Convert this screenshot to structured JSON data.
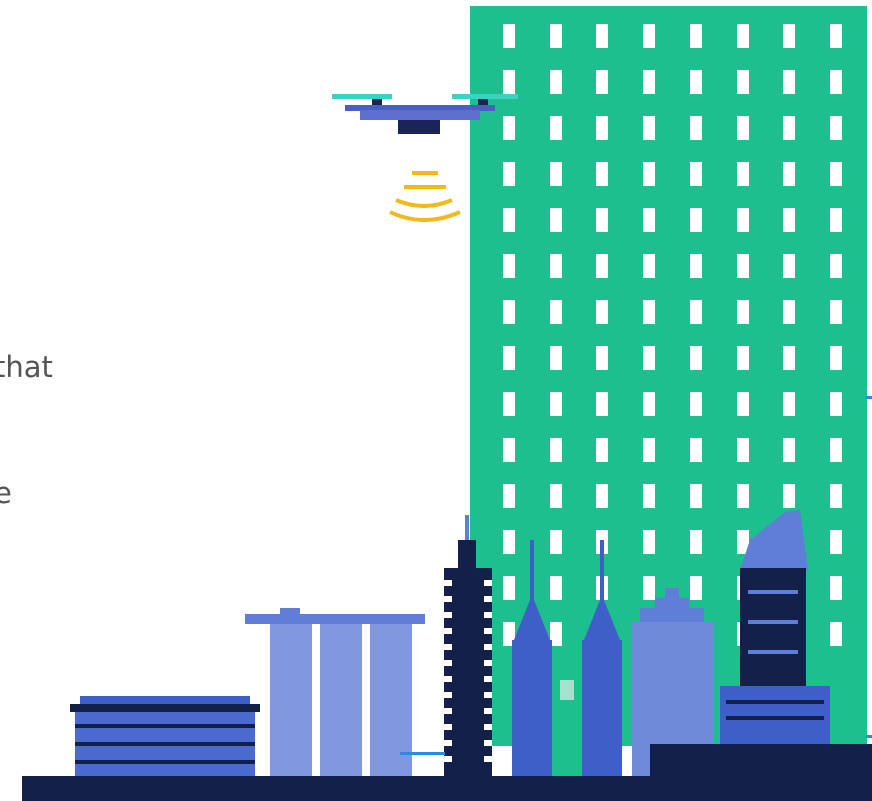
{
  "intro": {
    "line1": "that",
    "line2": "e"
  },
  "colors": {
    "tower_green": "#1ebf8e",
    "window_white": "#ffffff",
    "navy": "#13214a",
    "blue": "#3f5fc8",
    "light_blue": "#5f7ed8",
    "drone_body": "#4a5fc0",
    "drone_dark": "#1b2456",
    "rotor_teal": "#3dd0c4",
    "signal_yellow": "#f3b91a",
    "accent_blue": "#2b8be0"
  },
  "scene": {
    "items": [
      "drone",
      "signal-waves",
      "green-tower",
      "city-skyline",
      "ground-strip"
    ]
  }
}
